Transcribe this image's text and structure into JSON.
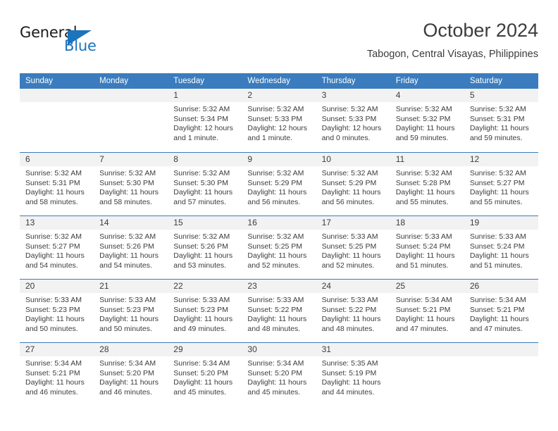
{
  "logo": {
    "word_top": "General",
    "word_bottom": "Blue",
    "accent_color": "#1b74bc"
  },
  "header": {
    "title": "October 2024",
    "location": "Tabogon, Central Visayas, Philippines"
  },
  "theme": {
    "header_blue": "#3a7cbe",
    "day_band_gray": "#f2f2f2",
    "text": "#3c3c3c"
  },
  "calendar": {
    "weekday_headers": [
      "Sunday",
      "Monday",
      "Tuesday",
      "Wednesday",
      "Thursday",
      "Friday",
      "Saturday"
    ],
    "weeks": [
      [
        {
          "day": "",
          "lines": []
        },
        {
          "day": "",
          "lines": []
        },
        {
          "day": "1",
          "lines": [
            "Sunrise: 5:32 AM",
            "Sunset: 5:34 PM",
            "Daylight: 12 hours",
            "and 1 minute."
          ]
        },
        {
          "day": "2",
          "lines": [
            "Sunrise: 5:32 AM",
            "Sunset: 5:33 PM",
            "Daylight: 12 hours",
            "and 1 minute."
          ]
        },
        {
          "day": "3",
          "lines": [
            "Sunrise: 5:32 AM",
            "Sunset: 5:33 PM",
            "Daylight: 12 hours",
            "and 0 minutes."
          ]
        },
        {
          "day": "4",
          "lines": [
            "Sunrise: 5:32 AM",
            "Sunset: 5:32 PM",
            "Daylight: 11 hours",
            "and 59 minutes."
          ]
        },
        {
          "day": "5",
          "lines": [
            "Sunrise: 5:32 AM",
            "Sunset: 5:31 PM",
            "Daylight: 11 hours",
            "and 59 minutes."
          ]
        }
      ],
      [
        {
          "day": "6",
          "lines": [
            "Sunrise: 5:32 AM",
            "Sunset: 5:31 PM",
            "Daylight: 11 hours",
            "and 58 minutes."
          ]
        },
        {
          "day": "7",
          "lines": [
            "Sunrise: 5:32 AM",
            "Sunset: 5:30 PM",
            "Daylight: 11 hours",
            "and 58 minutes."
          ]
        },
        {
          "day": "8",
          "lines": [
            "Sunrise: 5:32 AM",
            "Sunset: 5:30 PM",
            "Daylight: 11 hours",
            "and 57 minutes."
          ]
        },
        {
          "day": "9",
          "lines": [
            "Sunrise: 5:32 AM",
            "Sunset: 5:29 PM",
            "Daylight: 11 hours",
            "and 56 minutes."
          ]
        },
        {
          "day": "10",
          "lines": [
            "Sunrise: 5:32 AM",
            "Sunset: 5:29 PM",
            "Daylight: 11 hours",
            "and 56 minutes."
          ]
        },
        {
          "day": "11",
          "lines": [
            "Sunrise: 5:32 AM",
            "Sunset: 5:28 PM",
            "Daylight: 11 hours",
            "and 55 minutes."
          ]
        },
        {
          "day": "12",
          "lines": [
            "Sunrise: 5:32 AM",
            "Sunset: 5:27 PM",
            "Daylight: 11 hours",
            "and 55 minutes."
          ]
        }
      ],
      [
        {
          "day": "13",
          "lines": [
            "Sunrise: 5:32 AM",
            "Sunset: 5:27 PM",
            "Daylight: 11 hours",
            "and 54 minutes."
          ]
        },
        {
          "day": "14",
          "lines": [
            "Sunrise: 5:32 AM",
            "Sunset: 5:26 PM",
            "Daylight: 11 hours",
            "and 54 minutes."
          ]
        },
        {
          "day": "15",
          "lines": [
            "Sunrise: 5:32 AM",
            "Sunset: 5:26 PM",
            "Daylight: 11 hours",
            "and 53 minutes."
          ]
        },
        {
          "day": "16",
          "lines": [
            "Sunrise: 5:32 AM",
            "Sunset: 5:25 PM",
            "Daylight: 11 hours",
            "and 52 minutes."
          ]
        },
        {
          "day": "17",
          "lines": [
            "Sunrise: 5:33 AM",
            "Sunset: 5:25 PM",
            "Daylight: 11 hours",
            "and 52 minutes."
          ]
        },
        {
          "day": "18",
          "lines": [
            "Sunrise: 5:33 AM",
            "Sunset: 5:24 PM",
            "Daylight: 11 hours",
            "and 51 minutes."
          ]
        },
        {
          "day": "19",
          "lines": [
            "Sunrise: 5:33 AM",
            "Sunset: 5:24 PM",
            "Daylight: 11 hours",
            "and 51 minutes."
          ]
        }
      ],
      [
        {
          "day": "20",
          "lines": [
            "Sunrise: 5:33 AM",
            "Sunset: 5:23 PM",
            "Daylight: 11 hours",
            "and 50 minutes."
          ]
        },
        {
          "day": "21",
          "lines": [
            "Sunrise: 5:33 AM",
            "Sunset: 5:23 PM",
            "Daylight: 11 hours",
            "and 50 minutes."
          ]
        },
        {
          "day": "22",
          "lines": [
            "Sunrise: 5:33 AM",
            "Sunset: 5:23 PM",
            "Daylight: 11 hours",
            "and 49 minutes."
          ]
        },
        {
          "day": "23",
          "lines": [
            "Sunrise: 5:33 AM",
            "Sunset: 5:22 PM",
            "Daylight: 11 hours",
            "and 48 minutes."
          ]
        },
        {
          "day": "24",
          "lines": [
            "Sunrise: 5:33 AM",
            "Sunset: 5:22 PM",
            "Daylight: 11 hours",
            "and 48 minutes."
          ]
        },
        {
          "day": "25",
          "lines": [
            "Sunrise: 5:34 AM",
            "Sunset: 5:21 PM",
            "Daylight: 11 hours",
            "and 47 minutes."
          ]
        },
        {
          "day": "26",
          "lines": [
            "Sunrise: 5:34 AM",
            "Sunset: 5:21 PM",
            "Daylight: 11 hours",
            "and 47 minutes."
          ]
        }
      ],
      [
        {
          "day": "27",
          "lines": [
            "Sunrise: 5:34 AM",
            "Sunset: 5:21 PM",
            "Daylight: 11 hours",
            "and 46 minutes."
          ]
        },
        {
          "day": "28",
          "lines": [
            "Sunrise: 5:34 AM",
            "Sunset: 5:20 PM",
            "Daylight: 11 hours",
            "and 46 minutes."
          ]
        },
        {
          "day": "29",
          "lines": [
            "Sunrise: 5:34 AM",
            "Sunset: 5:20 PM",
            "Daylight: 11 hours",
            "and 45 minutes."
          ]
        },
        {
          "day": "30",
          "lines": [
            "Sunrise: 5:34 AM",
            "Sunset: 5:20 PM",
            "Daylight: 11 hours",
            "and 45 minutes."
          ]
        },
        {
          "day": "31",
          "lines": [
            "Sunrise: 5:35 AM",
            "Sunset: 5:19 PM",
            "Daylight: 11 hours",
            "and 44 minutes."
          ]
        },
        {
          "day": "",
          "lines": []
        },
        {
          "day": "",
          "lines": []
        }
      ]
    ]
  }
}
